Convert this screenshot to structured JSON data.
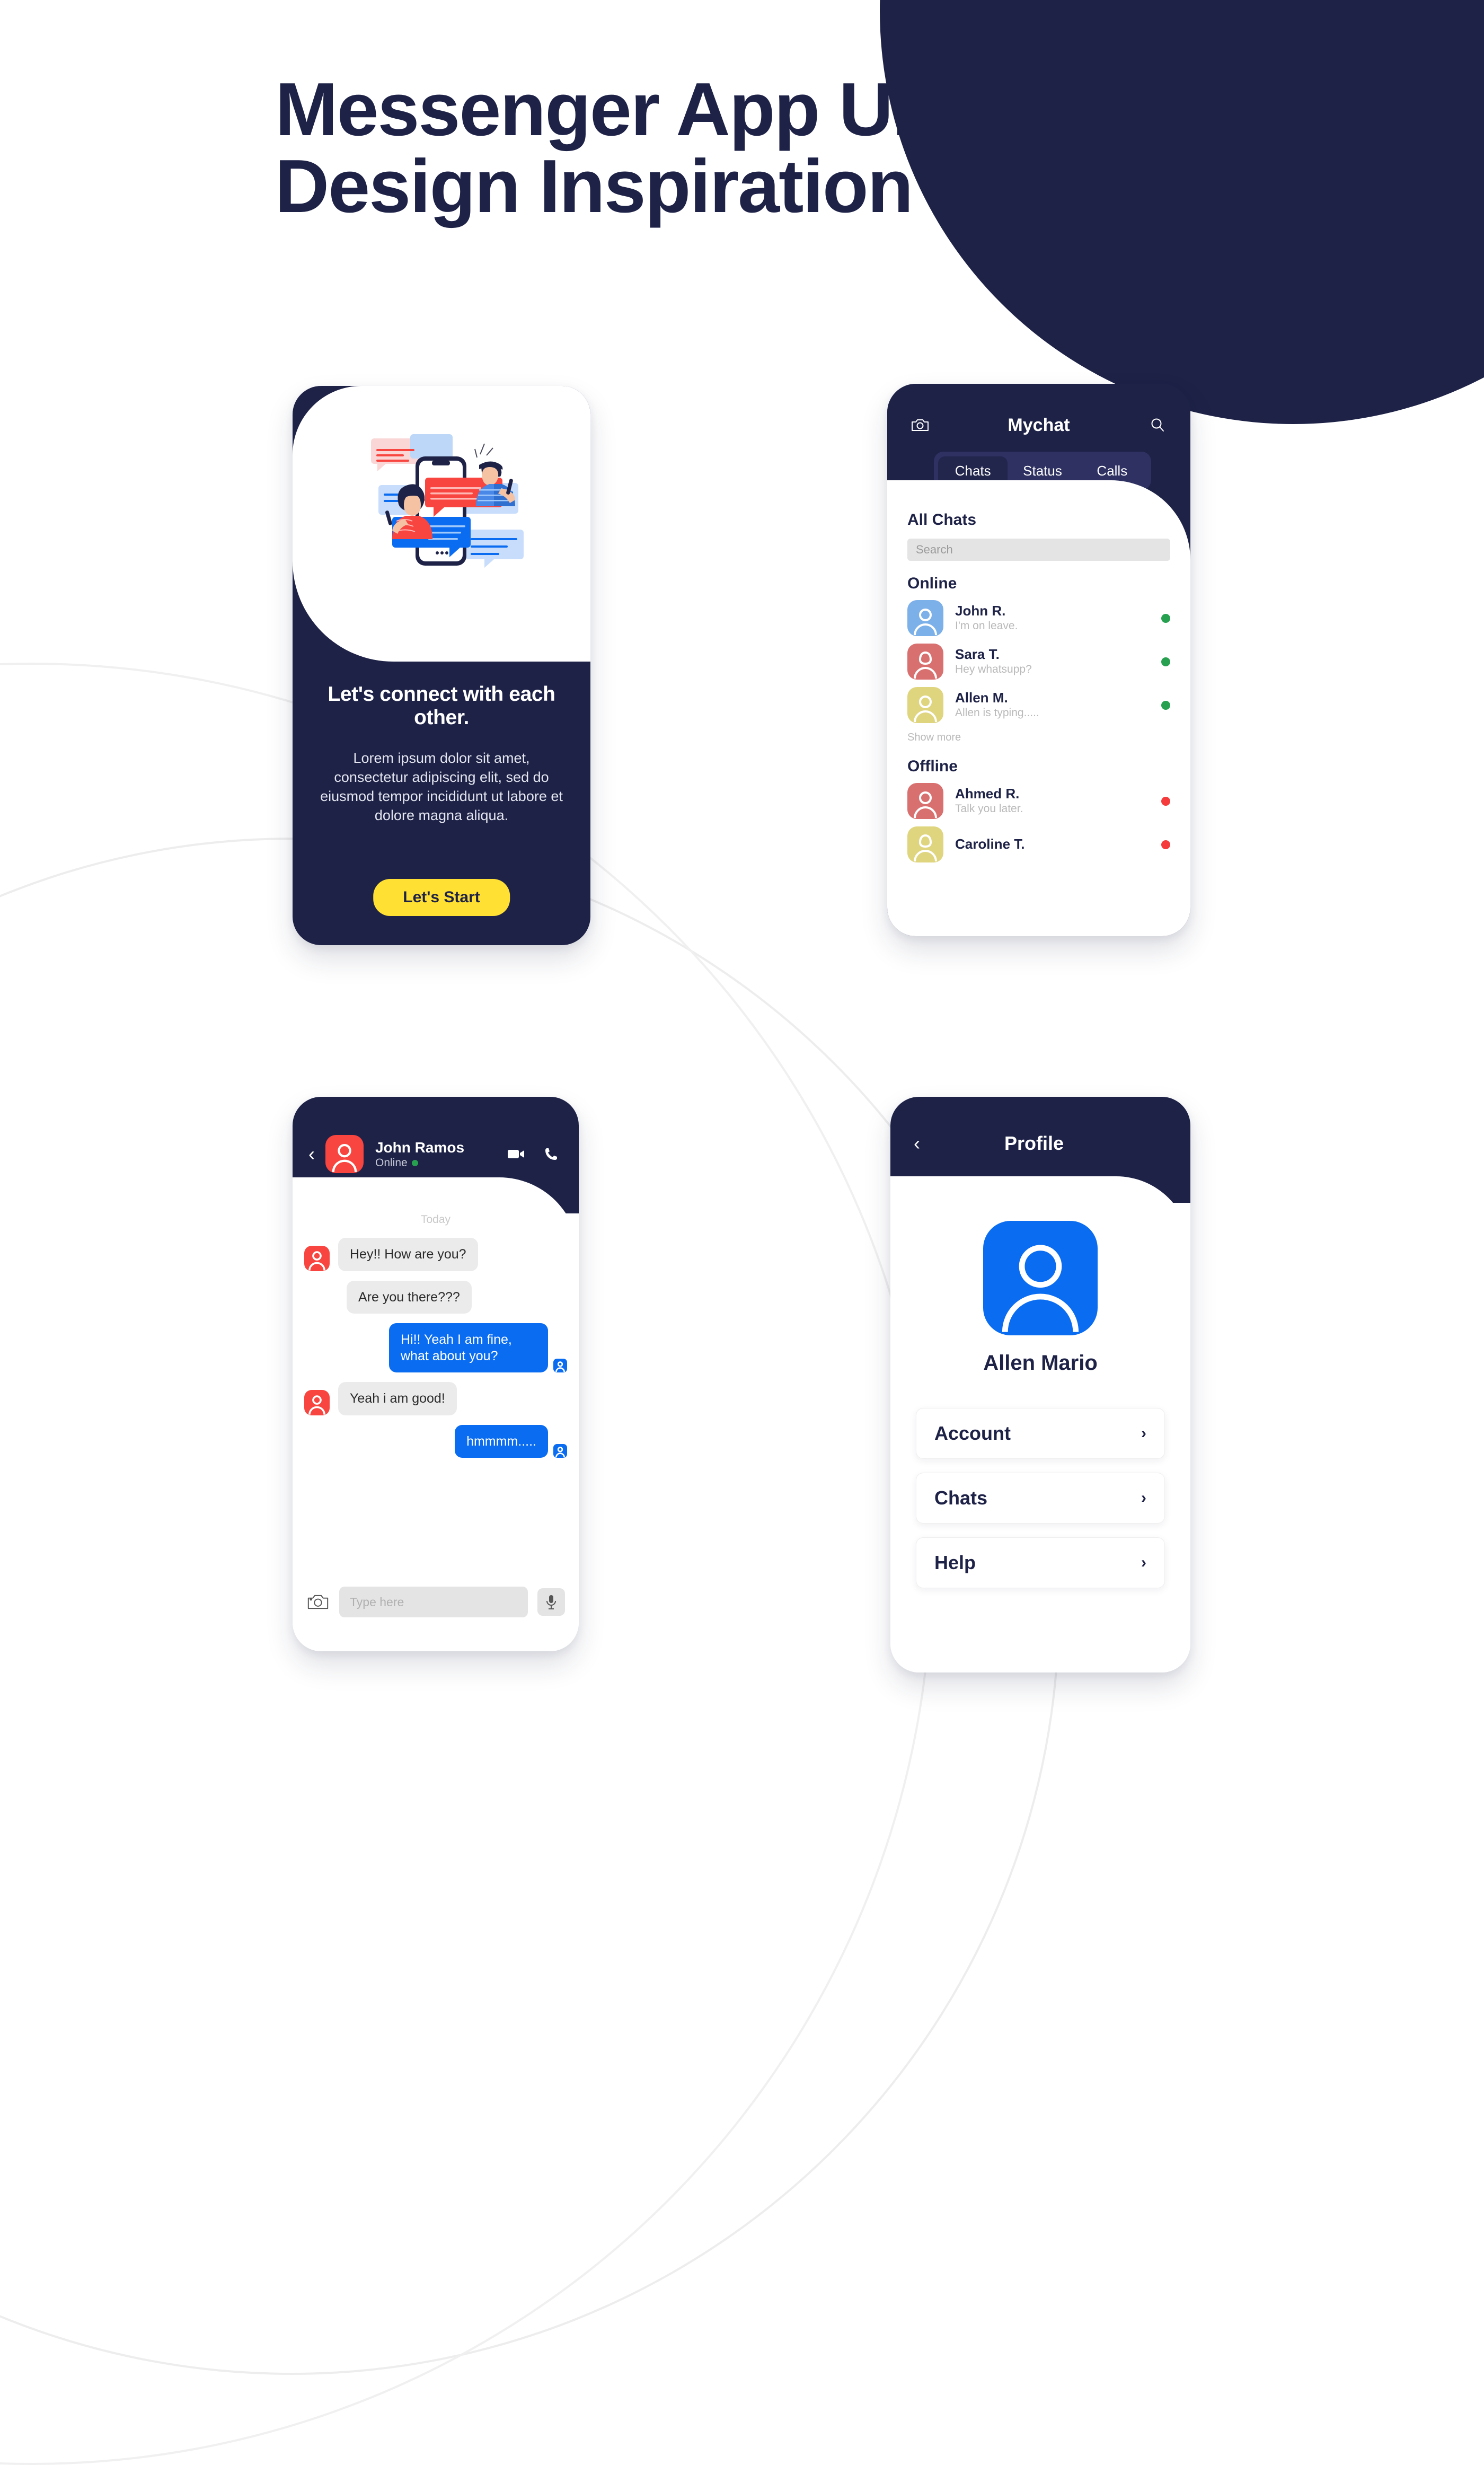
{
  "poster": {
    "title_line1": "Messenger App UI",
    "title_line2": "Design Inspiration",
    "brand_navy": "#1e2247",
    "accent_yellow": "#FFE033",
    "accent_blue": "#0a6cf1",
    "accent_red": "#f8453f"
  },
  "onboarding": {
    "heading": "Let's connect with each other.",
    "body": "Lorem ipsum dolor sit amet, consectetur adipiscing elit, sed do eiusmod tempor incididunt ut labore et dolore magna aliqua.",
    "cta_label": "Let's Start",
    "illustration_name": "two-people-chatting-illustration"
  },
  "chatlist": {
    "app_title": "Mychat",
    "camera_icon": "camera-icon",
    "search_icon": "search-icon",
    "tabs": [
      {
        "label": "Chats",
        "active": true
      },
      {
        "label": "Status",
        "active": false
      },
      {
        "label": "Calls",
        "active": false
      }
    ],
    "section_title": "All Chats",
    "search_placeholder": "Search",
    "search_value": "",
    "group_online_label": "Online",
    "group_offline_label": "Offline",
    "show_more_label": "Show more",
    "online": [
      {
        "name": "John R.",
        "preview": "I'm on leave.",
        "avatar_color": "#7cb0e8",
        "avatar_type": "male",
        "status": "online"
      },
      {
        "name": "Sara T.",
        "preview": "Hey whatsupp?",
        "avatar_color": "#d97070",
        "avatar_type": "female",
        "status": "online"
      },
      {
        "name": "Allen M.",
        "preview": "Allen is typing.....",
        "avatar_color": "#dfd57f",
        "avatar_type": "male",
        "status": "online"
      }
    ],
    "offline": [
      {
        "name": "Ahmed R.",
        "preview": "Talk you later.",
        "avatar_color": "#d97070",
        "avatar_type": "male",
        "status": "offline"
      },
      {
        "name": "Caroline T.",
        "preview": "",
        "avatar_color": "#dfd57f",
        "avatar_type": "female",
        "status": "offline"
      }
    ]
  },
  "conversation": {
    "back_icon": "chevron-left-icon",
    "contact_name": "John Ramos",
    "contact_status": "Online",
    "video_icon": "video-camera-icon",
    "call_icon": "phone-icon",
    "day_divider": "Today",
    "messages": [
      {
        "text": "Hey!! How are you?",
        "side": "in",
        "avatar": true
      },
      {
        "text": "Are you there???",
        "side": "in",
        "avatar": false
      },
      {
        "text": "Hi!! Yeah I am fine, what about you?",
        "side": "out",
        "avatar": true
      },
      {
        "text": "Yeah i am good!",
        "side": "in",
        "avatar": true
      },
      {
        "text": "hmmmm.....",
        "side": "out",
        "avatar": true
      }
    ],
    "composer_placeholder": "Type here",
    "composer_value": "",
    "camera_icon": "camera-icon",
    "mic_icon": "microphone-icon"
  },
  "profile": {
    "back_icon": "chevron-left-icon",
    "title": "Profile",
    "user_name": "Allen Mario",
    "avatar_color": "#0a6cf1",
    "menu": [
      {
        "label": "Account"
      },
      {
        "label": "Chats"
      },
      {
        "label": "Help"
      }
    ],
    "chevron": "›"
  }
}
